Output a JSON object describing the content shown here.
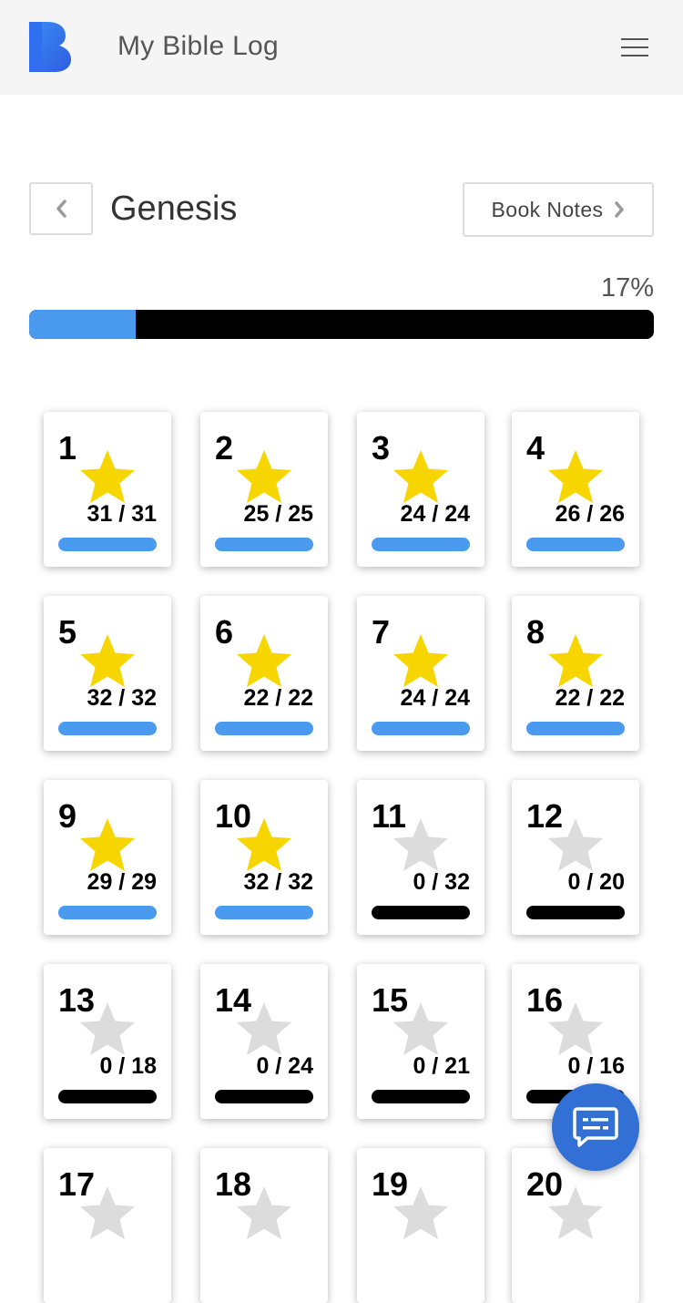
{
  "header": {
    "app_title": "My Bible Log",
    "logo_icon": "bible-log-logo",
    "menu_icon": "hamburger-menu-icon"
  },
  "book": {
    "title": "Genesis",
    "notes_label": "Book Notes",
    "progress_percent_label": "17%",
    "progress_fraction": 0.17
  },
  "colors": {
    "accent": "#4a9af0",
    "star_complete": "#f7d600",
    "star_incomplete": "#dcdcdc",
    "bar_incomplete": "#000000",
    "fab": "#3370d6"
  },
  "chapters": [
    {
      "num": "1",
      "count": "31 / 31",
      "complete": true
    },
    {
      "num": "2",
      "count": "25 / 25",
      "complete": true
    },
    {
      "num": "3",
      "count": "24 / 24",
      "complete": true
    },
    {
      "num": "4",
      "count": "26 / 26",
      "complete": true
    },
    {
      "num": "5",
      "count": "32 / 32",
      "complete": true
    },
    {
      "num": "6",
      "count": "22 / 22",
      "complete": true
    },
    {
      "num": "7",
      "count": "24 / 24",
      "complete": true
    },
    {
      "num": "8",
      "count": "22 / 22",
      "complete": true
    },
    {
      "num": "9",
      "count": "29 / 29",
      "complete": true
    },
    {
      "num": "10",
      "count": "32 / 32",
      "complete": true
    },
    {
      "num": "11",
      "count": "0 / 32",
      "complete": false
    },
    {
      "num": "12",
      "count": "0 / 20",
      "complete": false
    },
    {
      "num": "13",
      "count": "0 / 18",
      "complete": false
    },
    {
      "num": "14",
      "count": "0 / 24",
      "complete": false
    },
    {
      "num": "15",
      "count": "0 / 21",
      "complete": false
    },
    {
      "num": "16",
      "count": "0 / 16",
      "complete": false
    },
    {
      "num": "17",
      "count": "",
      "complete": false
    },
    {
      "num": "18",
      "count": "",
      "complete": false
    },
    {
      "num": "19",
      "count": "",
      "complete": false
    },
    {
      "num": "20",
      "count": "",
      "complete": false
    }
  ],
  "fab": {
    "icon": "chat-message-icon"
  }
}
